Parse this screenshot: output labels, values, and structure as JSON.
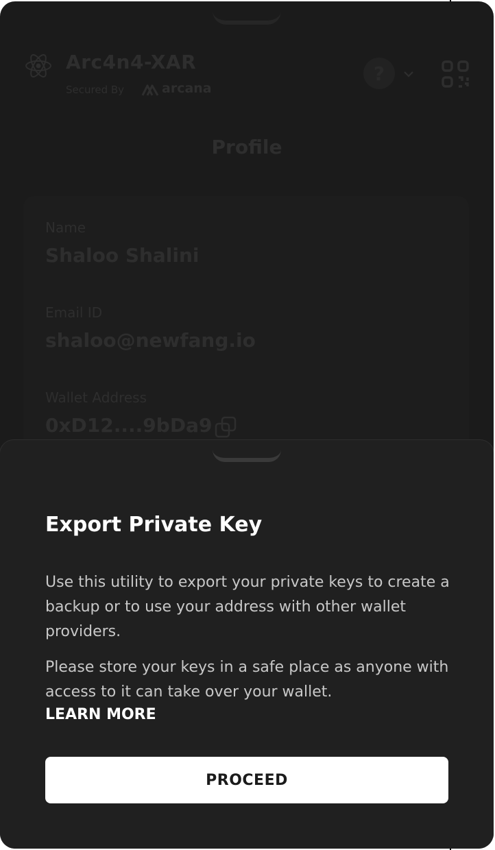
{
  "header": {
    "app_title": "Arc4n4-XAR",
    "secured_by": "Secured By",
    "brand_name": "arcana",
    "help_symbol": "?"
  },
  "page": {
    "title": "Profile"
  },
  "profile": {
    "name_label": "Name",
    "name_value": "Shaloo Shalini",
    "email_label": "Email ID",
    "email_value": "shaloo@newfang.io",
    "wallet_label": "Wallet Address",
    "wallet_value": "0xD12....9bDa9"
  },
  "sheet": {
    "title": "Export Private Key",
    "paragraph1": "Use this utility to export your private keys to create a backup or to use your address with other wallet providers.",
    "paragraph2": "Please store your keys in a safe place as anyone with access to it can take over your wallet.",
    "learn_more": "LEARN MORE",
    "proceed_label": "PROCEED"
  },
  "icons": {
    "logo": "react-atom-icon",
    "help": "question-icon",
    "dropdown": "chevron-down-icon",
    "qr": "qr-code-icon",
    "copy": "copy-icon"
  },
  "colors": {
    "background": "#1b1b1b",
    "sheet": "#202020",
    "button": "#ffffff"
  }
}
